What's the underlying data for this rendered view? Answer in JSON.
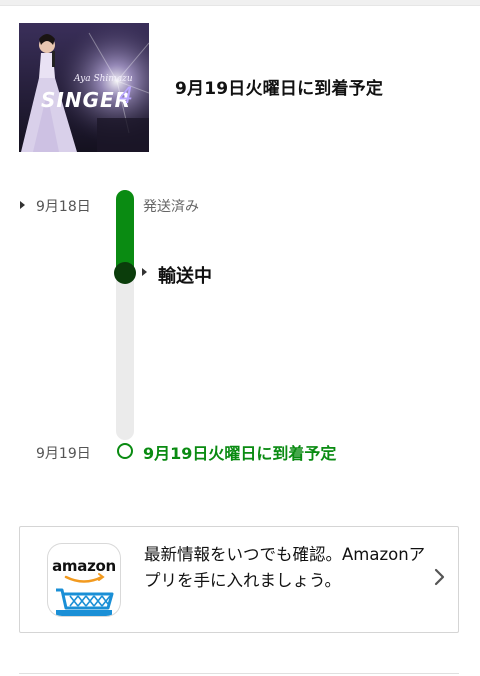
{
  "header": {
    "title": "9月19日火曜日に到着予定",
    "product_image": "album-cover-image"
  },
  "timeline": {
    "date_shipped": "9月18日",
    "date_arrival": "9月19日",
    "step_shipped": "発送済み",
    "step_transit": "輸送中",
    "step_arrival": "9月19日火曜日に到着予定",
    "progress": 0.35,
    "accent_color": "#0a8b12",
    "current_color": "#0b3d0b",
    "track_color": "#ebebeb"
  },
  "promo": {
    "icon_text": "amazon",
    "icon_name": "amazon-app-icon",
    "text": "最新情報をいつでも確認。Amazonアプリを手に入れましょう。",
    "chevron": "chevron-right-icon"
  }
}
